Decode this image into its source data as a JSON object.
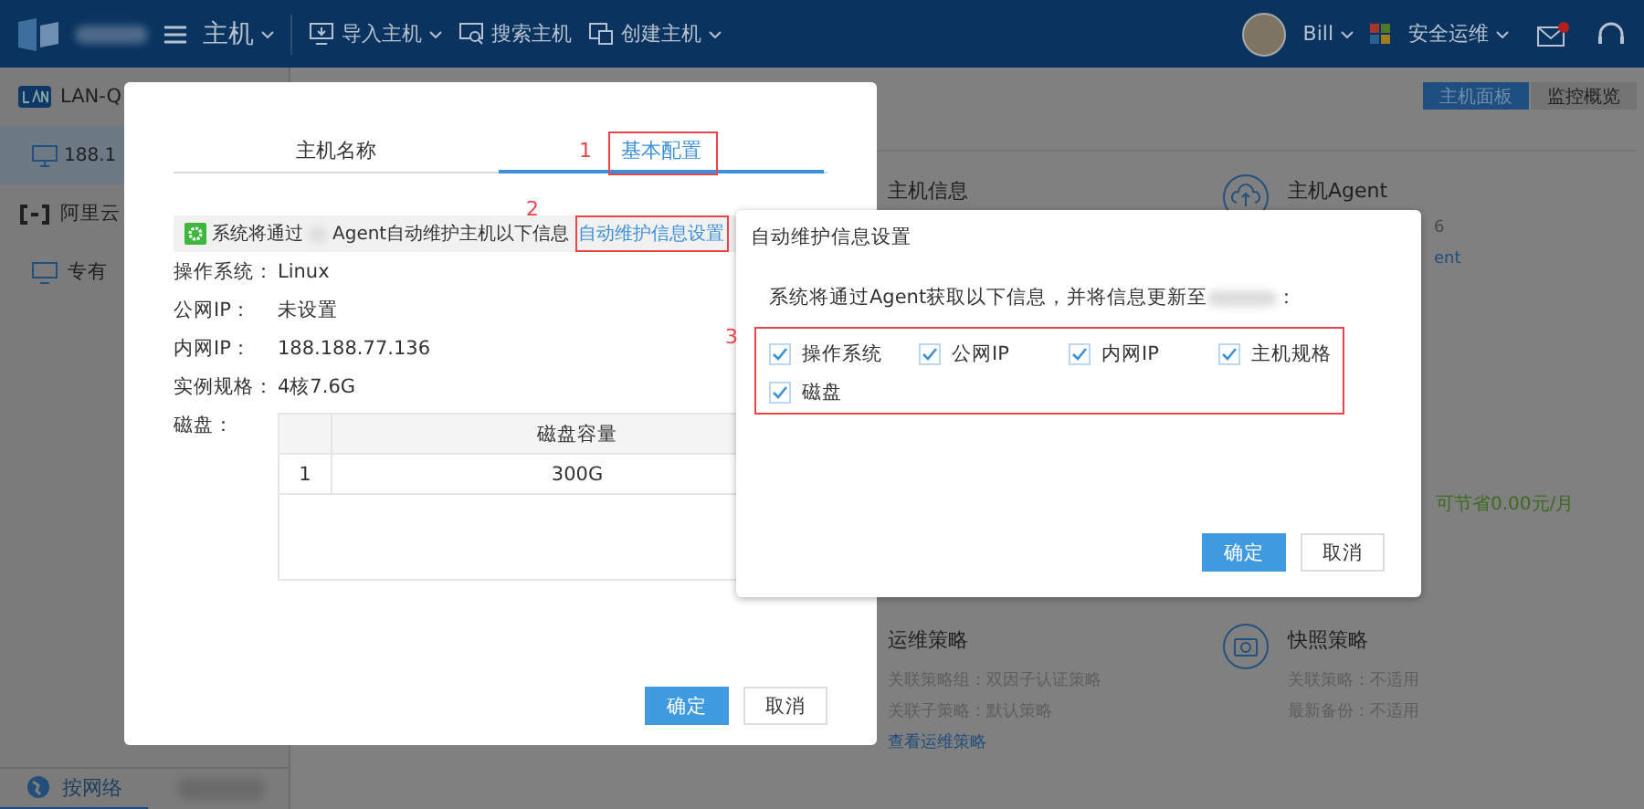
{
  "header": {
    "menu_title": "主机",
    "actions": [
      {
        "label": "导入主机",
        "kind": "import",
        "dropdown": true
      },
      {
        "label": "搜索主机",
        "kind": "search",
        "dropdown": false
      },
      {
        "label": "创建主机",
        "kind": "create",
        "dropdown": true
      }
    ],
    "user": "Bill",
    "workspace": "安全运维",
    "has_notification": true
  },
  "sidebar": {
    "items": [
      {
        "label": "LAN-Q",
        "kind": "lan",
        "selected": false
      },
      {
        "label": "188.1",
        "kind": "host",
        "selected": true
      },
      {
        "label": "阿里云",
        "kind": "cloud",
        "selected": false
      },
      {
        "label": "专有",
        "kind": "vpc",
        "selected": false
      }
    ],
    "bottom_tabs": [
      {
        "label": "按网络",
        "selected": true
      }
    ]
  },
  "main": {
    "tabs": [
      {
        "label": "主机面板",
        "selected": true
      },
      {
        "label": "监控概览",
        "selected": false
      }
    ],
    "host_info": {
      "title": "主机信息"
    },
    "agent": {
      "title": "主机Agent",
      "lines": [
        "6",
        "ent"
      ]
    },
    "savings": "可节省0.00元/月",
    "ops_policy": {
      "title": "运维策略",
      "lines": [
        "关联策略组：双因子认证策略",
        "关联子策略：默认策略"
      ],
      "link": "查看运维策略"
    },
    "snapshot": {
      "title": "快照策略",
      "lines": [
        "关联策略：不适用",
        "最新备份：不适用"
      ]
    }
  },
  "dialog": {
    "tabs": [
      {
        "label": "主机名称",
        "selected": false
      },
      {
        "label": "基本配置",
        "selected": true
      }
    ],
    "notice": {
      "before": "系统将通过",
      "after": "Agent自动维护主机以下信息",
      "link": "自动维护信息设置"
    },
    "fields": [
      {
        "label": "操作系统：",
        "value": "Linux"
      },
      {
        "label": "公网IP：",
        "value": "未设置"
      },
      {
        "label": "内网IP：",
        "value": "188.188.77.136"
      },
      {
        "label": "实例规格：",
        "value": "4核7.6G"
      }
    ],
    "disk": {
      "label": "磁盘：",
      "columns": [
        "",
        "磁盘容量"
      ],
      "rows": [
        [
          "1",
          "300G"
        ]
      ]
    },
    "buttons": [
      {
        "label": "确定",
        "kind": "primary"
      },
      {
        "label": "取消",
        "kind": "default"
      }
    ]
  },
  "settings_dialog": {
    "title": "自动维护信息设置",
    "text_before": "系统将通过Agent获取以下信息，并将信息更新至",
    "text_after": "：",
    "options": [
      {
        "label": "操作系统",
        "checked": true
      },
      {
        "label": "公网IP",
        "checked": true
      },
      {
        "label": "内网IP",
        "checked": true
      },
      {
        "label": "主机规格",
        "checked": true
      },
      {
        "label": "磁盘",
        "checked": true
      }
    ],
    "buttons": [
      {
        "label": "确定",
        "kind": "primary"
      },
      {
        "label": "取消",
        "kind": "default"
      }
    ]
  },
  "annotations": [
    "1",
    "2",
    "3"
  ]
}
